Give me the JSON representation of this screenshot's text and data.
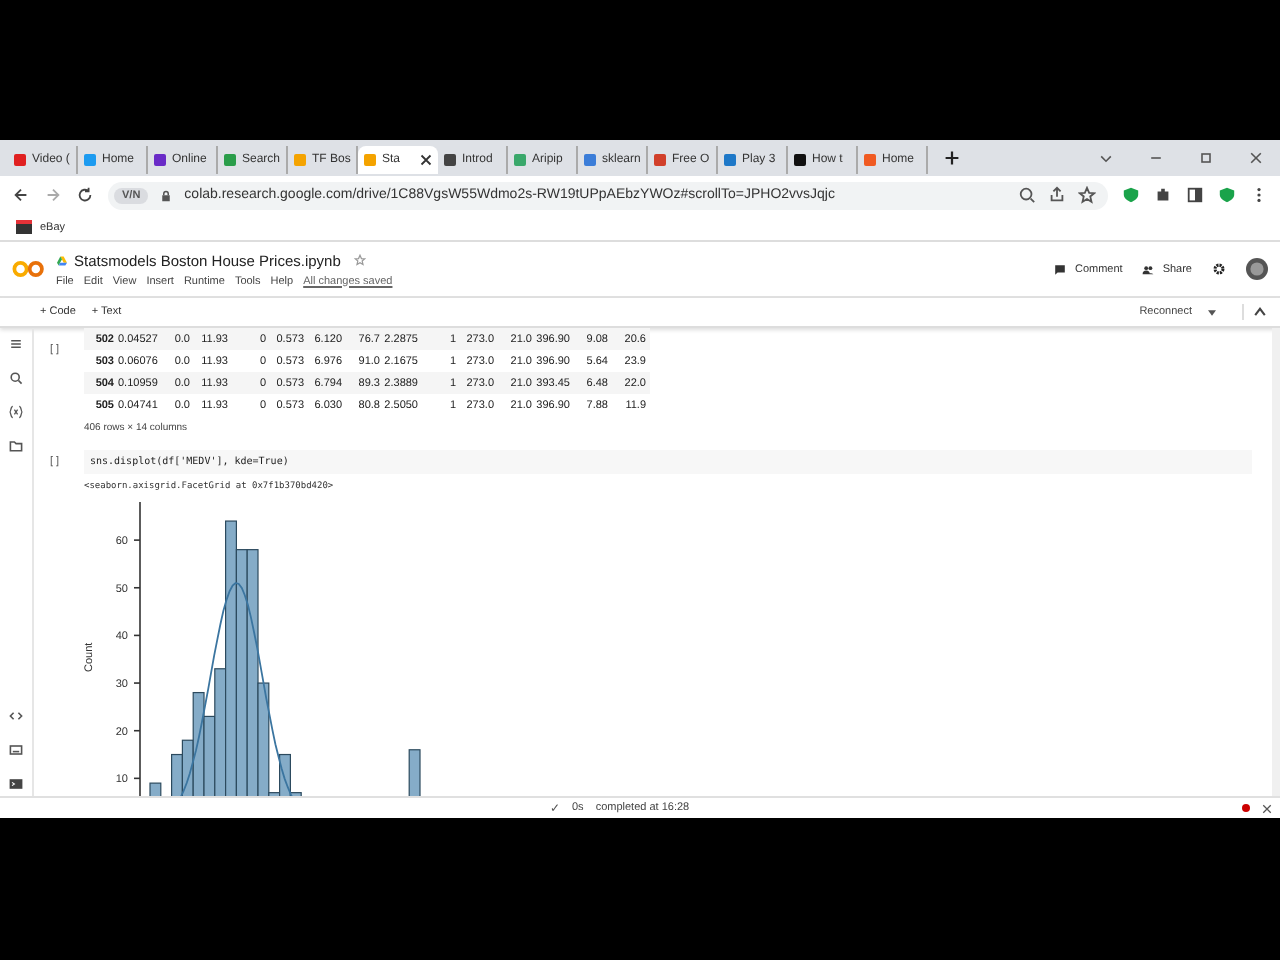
{
  "browser": {
    "tabs": [
      {
        "label": "Video (",
        "selected": false,
        "color": "#e02020"
      },
      {
        "label": "Home",
        "selected": false,
        "color": "#1d9bf0"
      },
      {
        "label": "Online",
        "selected": false,
        "color": "#6a2bc7"
      },
      {
        "label": "Search",
        "selected": false,
        "color": "#2a9d4a"
      },
      {
        "label": "TF Bos",
        "selected": false,
        "color": "#f4a300"
      },
      {
        "label": "Sta",
        "selected": true,
        "color": "#f4a300"
      },
      {
        "label": "Introd",
        "selected": false,
        "color": "#444444"
      },
      {
        "label": "Aripip",
        "selected": false,
        "color": "#3aa86b"
      },
      {
        "label": "sklearn",
        "selected": false,
        "color": "#3b7dd8"
      },
      {
        "label": "Free O",
        "selected": false,
        "color": "#d13f2a"
      },
      {
        "label": "Play 3",
        "selected": false,
        "color": "#1e78c8"
      },
      {
        "label": "How t",
        "selected": false,
        "color": "#111111"
      },
      {
        "label": "Home",
        "selected": false,
        "color": "#f05a22"
      }
    ],
    "url_badge": "V/N",
    "url": "colab.research.google.com/drive/1C88VgsW55Wdmo2s-RW19tUPpAEbzYWOz#scrollTo=JPHO2vvsJqjc",
    "bookmarks": [
      "eBay"
    ]
  },
  "notebook": {
    "title": "Statsmodels Boston House Prices.ipynb",
    "menu": [
      "File",
      "Edit",
      "View",
      "Insert",
      "Runtime",
      "Tools",
      "Help"
    ],
    "save_status": "All changes saved",
    "header_actions": [
      "Comment",
      "Share"
    ],
    "toolbar": [
      "+ Code",
      "+ Text"
    ],
    "runtime": "Reconnect"
  },
  "output_table": {
    "rows": [
      [
        "502",
        "0.04527",
        "0.0",
        "11.93",
        "0",
        "0.573",
        "6.120",
        "76.7",
        "2.2875",
        "1",
        "273.0",
        "21.0",
        "396.90",
        "9.08",
        "20.6"
      ],
      [
        "503",
        "0.06076",
        "0.0",
        "11.93",
        "0",
        "0.573",
        "6.976",
        "91.0",
        "2.1675",
        "1",
        "273.0",
        "21.0",
        "396.90",
        "5.64",
        "23.9"
      ],
      [
        "504",
        "0.10959",
        "0.0",
        "11.93",
        "0",
        "0.573",
        "6.794",
        "89.3",
        "2.3889",
        "1",
        "273.0",
        "21.0",
        "393.45",
        "6.48",
        "22.0"
      ],
      [
        "505",
        "0.04741",
        "0.0",
        "11.93",
        "0",
        "0.573",
        "6.030",
        "80.8",
        "2.5050",
        "1",
        "273.0",
        "21.0",
        "396.90",
        "7.88",
        "11.9"
      ]
    ],
    "summary": "406 rows × 14 columns",
    "run_marker": "[ ]"
  },
  "code_cell": {
    "run_marker": "[ ]",
    "code": "sns.displot(df['MEDV'], kde=True)",
    "output": "<seaborn.axisgrid.FacetGrid at 0x7f1b370bd420>",
    "plot": {
      "kind": "histogram",
      "ylabel": "Count",
      "yticks": [
        "60",
        "50",
        "40",
        "30",
        "20",
        "10"
      ]
    }
  },
  "status_bar": {
    "check": "✓",
    "duration": "0s",
    "text": "completed at 16:28"
  }
}
